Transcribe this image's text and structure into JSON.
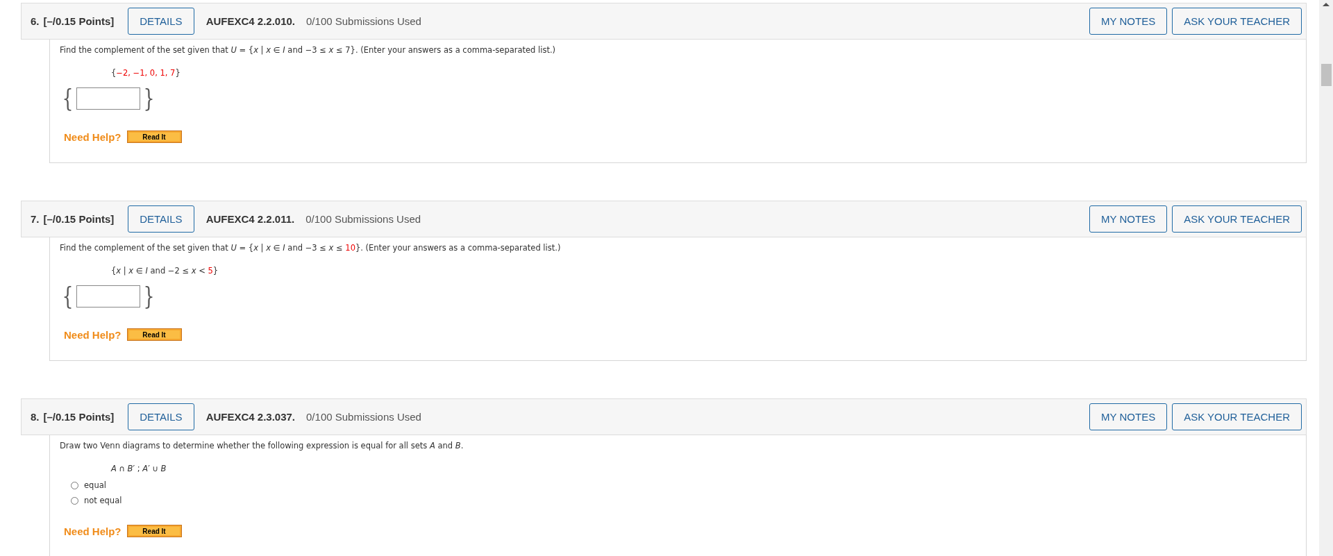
{
  "questions": [
    {
      "number": "6.",
      "points": "[–/0.15 Points]",
      "details": "DETAILS",
      "code": "AUFEXC4 2.2.010.",
      "submissions": "0/100 Submissions Used",
      "notes_button": "MY NOTES",
      "teacher_button": "ASK YOUR TEACHER",
      "prompt": [
        {
          "text": "Find the complement of the set given that *U* = {*x* | *x* ∈ *I* and −3 ≤ *x* ≤ 7}. (Enter your answers as a comma-separated list.)",
          "highlight": false
        }
      ],
      "given": [
        {
          "text": "{",
          "highlight": false
        },
        {
          "text": "−2, −1, 0, 1, 7",
          "highlight": true
        },
        {
          "text": "}",
          "highlight": false
        }
      ],
      "answer": {
        "kind": "set",
        "brace_open": "{",
        "brace_close": "}"
      },
      "help": "Need Help?",
      "help_button": "Read It"
    },
    {
      "number": "7.",
      "points": "[–/0.15 Points]",
      "details": "DETAILS",
      "code": "AUFEXC4 2.2.011.",
      "submissions": "0/100 Submissions Used",
      "notes_button": "MY NOTES",
      "teacher_button": "ASK YOUR TEACHER",
      "prompt": [
        {
          "text": "Find the complement of the set given that *U* = {*x* | *x* ∈ *I* and −3 ≤ *x* ≤ ",
          "highlight": false
        },
        {
          "text": "10",
          "highlight": true
        },
        {
          "text": "}. (Enter your answers as a comma-separated list.)",
          "highlight": false
        }
      ],
      "given": [
        {
          "text": "{*x* | *x* ∈ *I* and −2 ≤ *x* < ",
          "highlight": false
        },
        {
          "text": "5",
          "highlight": true
        },
        {
          "text": "}",
          "highlight": false
        }
      ],
      "answer": {
        "kind": "set",
        "brace_open": "{",
        "brace_close": "}"
      },
      "help": "Need Help?",
      "help_button": "Read It"
    },
    {
      "number": "8.",
      "points": "[–/0.15 Points]",
      "details": "DETAILS",
      "code": "AUFEXC4 2.3.037.",
      "submissions": "0/100 Submissions Used",
      "notes_button": "MY NOTES",
      "teacher_button": "ASK YOUR TEACHER",
      "prompt": [
        {
          "text": "Draw two Venn diagrams to determine whether the following expression is equal for all sets *A* and *B*.",
          "highlight": false
        }
      ],
      "given": [
        {
          "text": "*A* ∩ *B*′ ; *A*′ ∪ *B*",
          "highlight": false
        }
      ],
      "answer": {
        "kind": "choice",
        "options": [
          {
            "label": "equal",
            "selected": false
          },
          {
            "label": "not equal",
            "selected": false
          }
        ]
      },
      "help": "Need Help?",
      "help_button": "Read It"
    }
  ]
}
